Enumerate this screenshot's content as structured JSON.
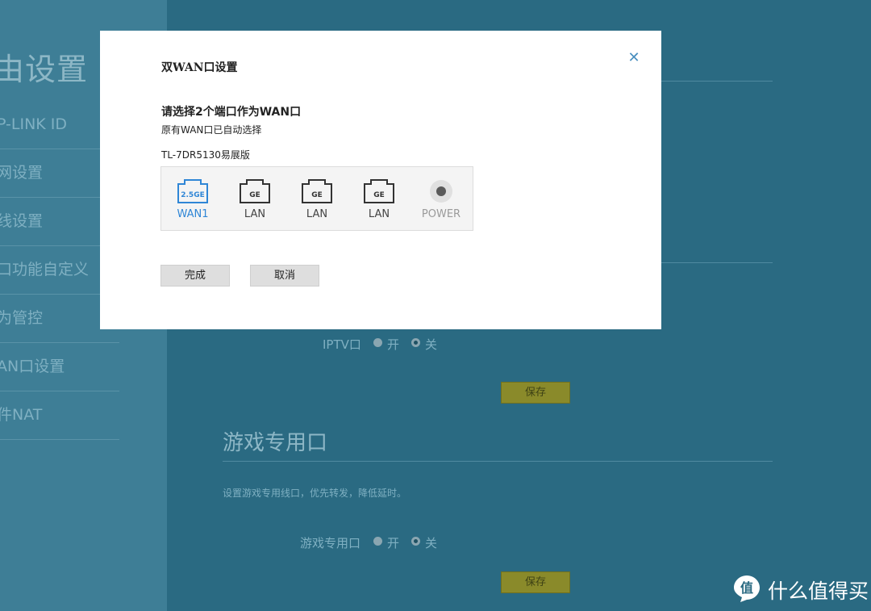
{
  "sidebar": {
    "title": "由设置",
    "items": [
      "P-LINK ID",
      "网设置",
      "线设置",
      "口功能自定义",
      "为管控",
      "AN口设置",
      "件NAT"
    ]
  },
  "main": {
    "iptv": {
      "label": "IPTV口",
      "on": "开",
      "off": "关",
      "selected": "off"
    },
    "save1": "保存",
    "game_section": {
      "title": "游戏专用口",
      "desc": "设置游戏专用线口，优先转发，降低延时。",
      "label": "游戏专用口",
      "on": "开",
      "off": "关",
      "selected": "off",
      "save": "保存"
    }
  },
  "modal": {
    "title": "双WAN口设置",
    "heading": "请选择2个端口作为WAN口",
    "subtext": "原有WAN口已自动选择",
    "model": "TL-7DR5130易展版",
    "ports": [
      {
        "badge": "2.5GE",
        "label": "WAN1",
        "selected": true,
        "icon": "ethernet-port-icon"
      },
      {
        "badge": "GE",
        "label": "LAN",
        "selected": false,
        "icon": "ethernet-port-icon"
      },
      {
        "badge": "GE",
        "label": "LAN",
        "selected": false,
        "icon": "ethernet-port-icon"
      },
      {
        "badge": "GE",
        "label": "LAN",
        "selected": false,
        "icon": "ethernet-port-icon"
      },
      {
        "badge": "",
        "label": "POWER",
        "selected": false,
        "icon": "power-port-icon"
      }
    ],
    "buttons": {
      "done": "完成",
      "cancel": "取消"
    },
    "close_icon": "close-icon"
  },
  "watermark": {
    "text": "什么值得买",
    "logo_glyph": "值",
    "icon": "smzdm-logo-icon"
  },
  "colors": {
    "accent": "#2f86d6",
    "overlay_bg": "#2a6a82",
    "save_button": "#8a8a2a"
  }
}
